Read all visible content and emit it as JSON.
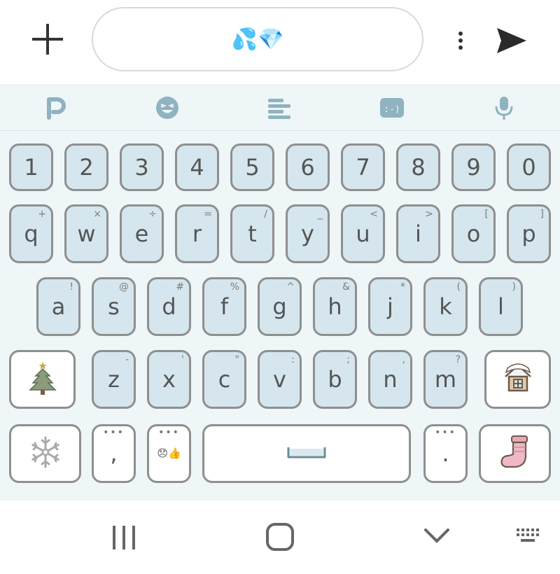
{
  "compose": {
    "text": "💦💎"
  },
  "row_numbers": [
    {
      "main": "1"
    },
    {
      "main": "2"
    },
    {
      "main": "3"
    },
    {
      "main": "4"
    },
    {
      "main": "5"
    },
    {
      "main": "6"
    },
    {
      "main": "7"
    },
    {
      "main": "8"
    },
    {
      "main": "9"
    },
    {
      "main": "0"
    }
  ],
  "row_top": [
    {
      "main": "q",
      "sub": "+"
    },
    {
      "main": "w",
      "sub": "×"
    },
    {
      "main": "e",
      "sub": "÷"
    },
    {
      "main": "r",
      "sub": "="
    },
    {
      "main": "t",
      "sub": "/"
    },
    {
      "main": "y",
      "sub": "_"
    },
    {
      "main": "u",
      "sub": "<"
    },
    {
      "main": "i",
      "sub": ">"
    },
    {
      "main": "o",
      "sub": "["
    },
    {
      "main": "p",
      "sub": "]"
    }
  ],
  "row_home": [
    {
      "main": "a",
      "sub": "!"
    },
    {
      "main": "s",
      "sub": "@"
    },
    {
      "main": "d",
      "sub": "#"
    },
    {
      "main": "f",
      "sub": "%"
    },
    {
      "main": "g",
      "sub": "^"
    },
    {
      "main": "h",
      "sub": "&"
    },
    {
      "main": "j",
      "sub": "*"
    },
    {
      "main": "k",
      "sub": "("
    },
    {
      "main": "l",
      "sub": ")"
    }
  ],
  "row_bottom": [
    {
      "main": "z",
      "sub": "-"
    },
    {
      "main": "x",
      "sub": "'"
    },
    {
      "main": "c",
      "sub": "\""
    },
    {
      "main": "v",
      "sub": ":"
    },
    {
      "main": "b",
      "sub": ";"
    },
    {
      "main": "n",
      "sub": ","
    },
    {
      "main": "m",
      "sub": "?"
    }
  ],
  "space_row": {
    "comma_main": ",",
    "comma_sub": "•••",
    "emoji_text": "😞👍",
    "emoji_sub": "•••",
    "period_main": ".",
    "period_sub": "•••"
  },
  "icons": {
    "plus": "plus-icon",
    "more": "more-vertical-icon",
    "send": "send-icon",
    "toolbar": [
      "p-logo-icon",
      "emoji-face-icon",
      "text-align-icon",
      "emoticon-icon",
      "microphone-icon"
    ],
    "shift_left": "christmas-tree-icon",
    "shift_right": "house-icon",
    "symbols": "snowflake-icon",
    "enter": "christmas-stocking-icon",
    "space": "space-bar-icon",
    "nav": [
      "recent-apps-icon",
      "home-icon",
      "back-chevron-icon",
      "keyboard-icon"
    ]
  },
  "colors": {
    "key_fill": "#d5e6ee",
    "key_border": "#8f8f8f",
    "keyboard_bg": "#eef6f7",
    "toolbar_icon": "#8fb3bf",
    "emoji_blue": "#3b82c6"
  }
}
